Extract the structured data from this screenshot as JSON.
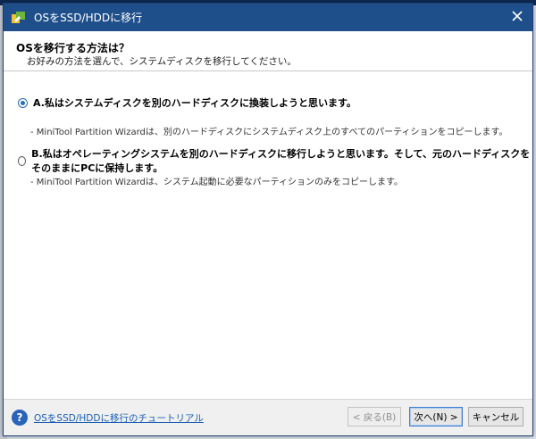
{
  "window": {
    "title": "OSをSSD/HDDに移行"
  },
  "header": {
    "title": "OSを移行する方法は？",
    "subtitle": "お好みの方法を選んで、システムディスクを移行してください。"
  },
  "options": [
    {
      "label": "A.私はシステムディスクを別のハードディスクに換装しようと思います。",
      "description": "- MiniTool Partition Wizardは、別のハードディスクにシステムディスク上のすべてのパーティションをコピーします。",
      "selected": true
    },
    {
      "label": "B.私はオペレーティングシステムを別のハードディスクに移行しようと思います。そして、元のハードディスクをそのままにPCに保持します。",
      "description": "- MiniTool Partition Wizardは、システム起動に必要なパーティションのみをコピーします。",
      "selected": false
    }
  ],
  "footer": {
    "help_link": "OSをSSD/HDDに移行のチュートリアル",
    "back_label": "< 戻る(B)",
    "next_label": "次へ(N) >",
    "cancel_label": "キャンセル"
  },
  "colors": {
    "titlebar": "#1f4f8b",
    "accent": "#2b6cb8",
    "link": "#1a5fb4"
  },
  "icons": {
    "app": "app-logo-icon",
    "close": "close-icon",
    "help": "help-icon"
  }
}
